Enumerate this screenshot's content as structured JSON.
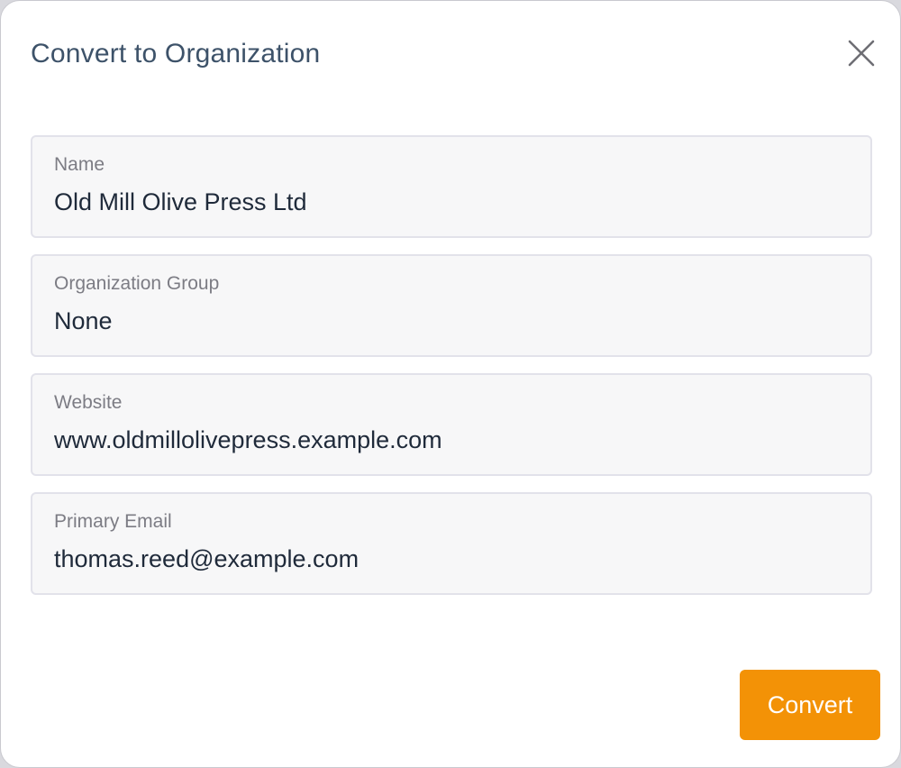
{
  "dialog": {
    "title": "Convert to Organization",
    "close_icon": "close-icon"
  },
  "fields": [
    {
      "label": "Name",
      "value": "Old Mill Olive Press Ltd"
    },
    {
      "label": "Organization Group",
      "value": "None"
    },
    {
      "label": "Website",
      "value": "www.oldmillolivepress.example.com"
    },
    {
      "label": "Primary Email",
      "value": "thomas.reed@example.com"
    }
  ],
  "actions": {
    "convert_label": "Convert"
  },
  "colors": {
    "accent": "#f39206",
    "title": "#3d5269",
    "field_bg": "#f7f7f8",
    "field_border": "#e2e2ea"
  }
}
